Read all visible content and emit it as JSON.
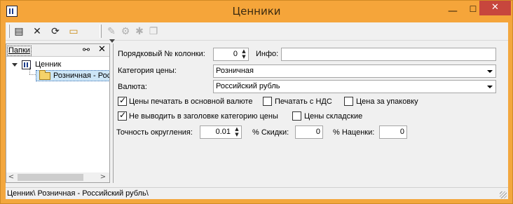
{
  "window": {
    "title": "Ценники",
    "controls": {
      "minimize": "—",
      "maximize": "☐",
      "close": "✕"
    }
  },
  "toolbar": {
    "icons": [
      "list-icon",
      "delete-icon",
      "refresh-icon",
      "open-folder-icon",
      "eraser-icon",
      "stamp-icon",
      "star-icon",
      "copy-icon"
    ],
    "glyphs": {
      "list": "▤",
      "delete": "✕",
      "refresh": "⟳",
      "folder": "▭",
      "eraser": "✎",
      "stamp": "⚙",
      "star": "✱",
      "copy": "❐"
    }
  },
  "left_pane": {
    "tab_label": "Папки",
    "search_glyph": "⚯",
    "close_glyph": "✕",
    "tree": {
      "root_label": "Ценник",
      "child_label": "Розничная - Российский рубль"
    },
    "scroll": {
      "left": "<",
      "right": ">"
    }
  },
  "form": {
    "column_no_label": "Порядковый № колонки:",
    "column_no_value": "0",
    "info_label": "Инфо:",
    "info_value": "",
    "price_category_label": "Категория цены:",
    "price_category_value": "Розничная",
    "currency_label": "Валюта:",
    "currency_value": "Российский рубль",
    "checkboxes": [
      {
        "label": "Цены печатать в основной валюте",
        "checked": true
      },
      {
        "label": "Печатать с НДС",
        "checked": false
      },
      {
        "label": "Цена за упаковку",
        "checked": false
      },
      {
        "label": "Не выводить в заголовке категорию цены",
        "checked": true
      },
      {
        "label": "Цены складские",
        "checked": false
      }
    ],
    "rounding_label": "Точность округления:",
    "rounding_value": "0.01",
    "discount_label": "% Скидки:",
    "discount_value": "0",
    "markup_label": "% Наценки:",
    "markup_value": "0"
  },
  "status": {
    "path": "Ценник\\ Розничная - Российский рубль\\"
  }
}
